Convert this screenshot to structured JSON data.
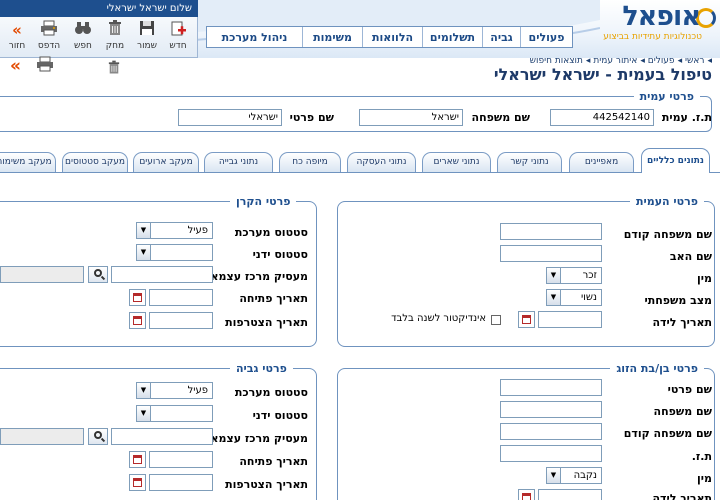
{
  "header": {
    "greeting": "שלום ישראל ישראלי",
    "logo_text": "אופאל",
    "logo_tagline": "טכנולוגיות עתידיות בביצוע",
    "nav": [
      "פעולים",
      "גביה",
      "תשלומים",
      "הלוואות",
      "משימות",
      "ניהול מערכת"
    ]
  },
  "toolbar": {
    "buttons": [
      {
        "label": "חדש",
        "icon": "new-doc-icon"
      },
      {
        "label": "שמור",
        "icon": "save-icon"
      },
      {
        "label": "מחק",
        "icon": "trash-icon"
      },
      {
        "label": "חפש",
        "icon": "binoculars-icon"
      },
      {
        "label": "הדפס",
        "icon": "printer-icon"
      },
      {
        "label": "חזור",
        "icon": "back-arrows-icon"
      }
    ]
  },
  "breadcrumbs": [
    "ראשי",
    "פעולים",
    "איתור עמית",
    "תוצאות חיפוש"
  ],
  "page_title": "טיפול בעמית - ישראל ישראלי",
  "client": {
    "legend": "פרטי עמית",
    "id_label": "ת.ז. עמית",
    "id_value": "442542140",
    "last_name_label": "שם משפחה",
    "last_name_value": "ישראל",
    "first_name_label": "שם פרטי",
    "first_name_value": "ישראלי"
  },
  "tabs": [
    "נתונים כלליים",
    "מאפיינים",
    "נתוני קשר",
    "נתוני שארים",
    "נתוני העסקה",
    "מיופה כח",
    "נתוני גבייה",
    "מעקב ארועים",
    "מעקב סטטוסים",
    "מעקב משימות"
  ],
  "member_details": {
    "legend": "פרטי העמית",
    "prev_last_name_label": "שם משפחה קודם",
    "father_name_label": "שם האב",
    "gender_label": "מין",
    "gender_value": "זכר",
    "marital_label": "מצב משפחתי",
    "marital_value": "נשוי",
    "birth_date_label": "תאריך לידה",
    "indicator_label": "אינדיקטור לשנה בלבד"
  },
  "fund_details": {
    "legend": "פרטי הקרן",
    "system_status_label": "סטטוס מערכת",
    "system_status_value": "פעיל",
    "manual_status_label": "סטטוס ידני",
    "employer_label": "מעסיק מרכז עצמאים",
    "open_date_label": "תאריך פתיחה",
    "join_date_label": "תאריך הצטרפות"
  },
  "spouse_details": {
    "legend": "פרטי בן/בת הזוג",
    "first_name_label": "שם פרטי",
    "last_name_label": "שם משפחה",
    "prev_last_name_label": "שם משפחה קודם",
    "id_label": "ת.ז.",
    "gender_label": "מין",
    "gender_value": "נקבה",
    "birth_date_label": "תאריך לידה"
  },
  "collection_details": {
    "legend": "פרטי גביה",
    "system_status_label": "סטטוס מערכת",
    "system_status_value": "פעיל",
    "manual_status_label": "סטטוס ידני",
    "employer_label": "מעסיק מרכז עצמאים",
    "open_date_label": "תאריך פתיחה",
    "join_date_label": "תאריך הצטרפות"
  },
  "colors": {
    "brand_blue": "#1e4f8e",
    "accent_orange": "#e8a200",
    "border_blue": "#6f93bf"
  }
}
